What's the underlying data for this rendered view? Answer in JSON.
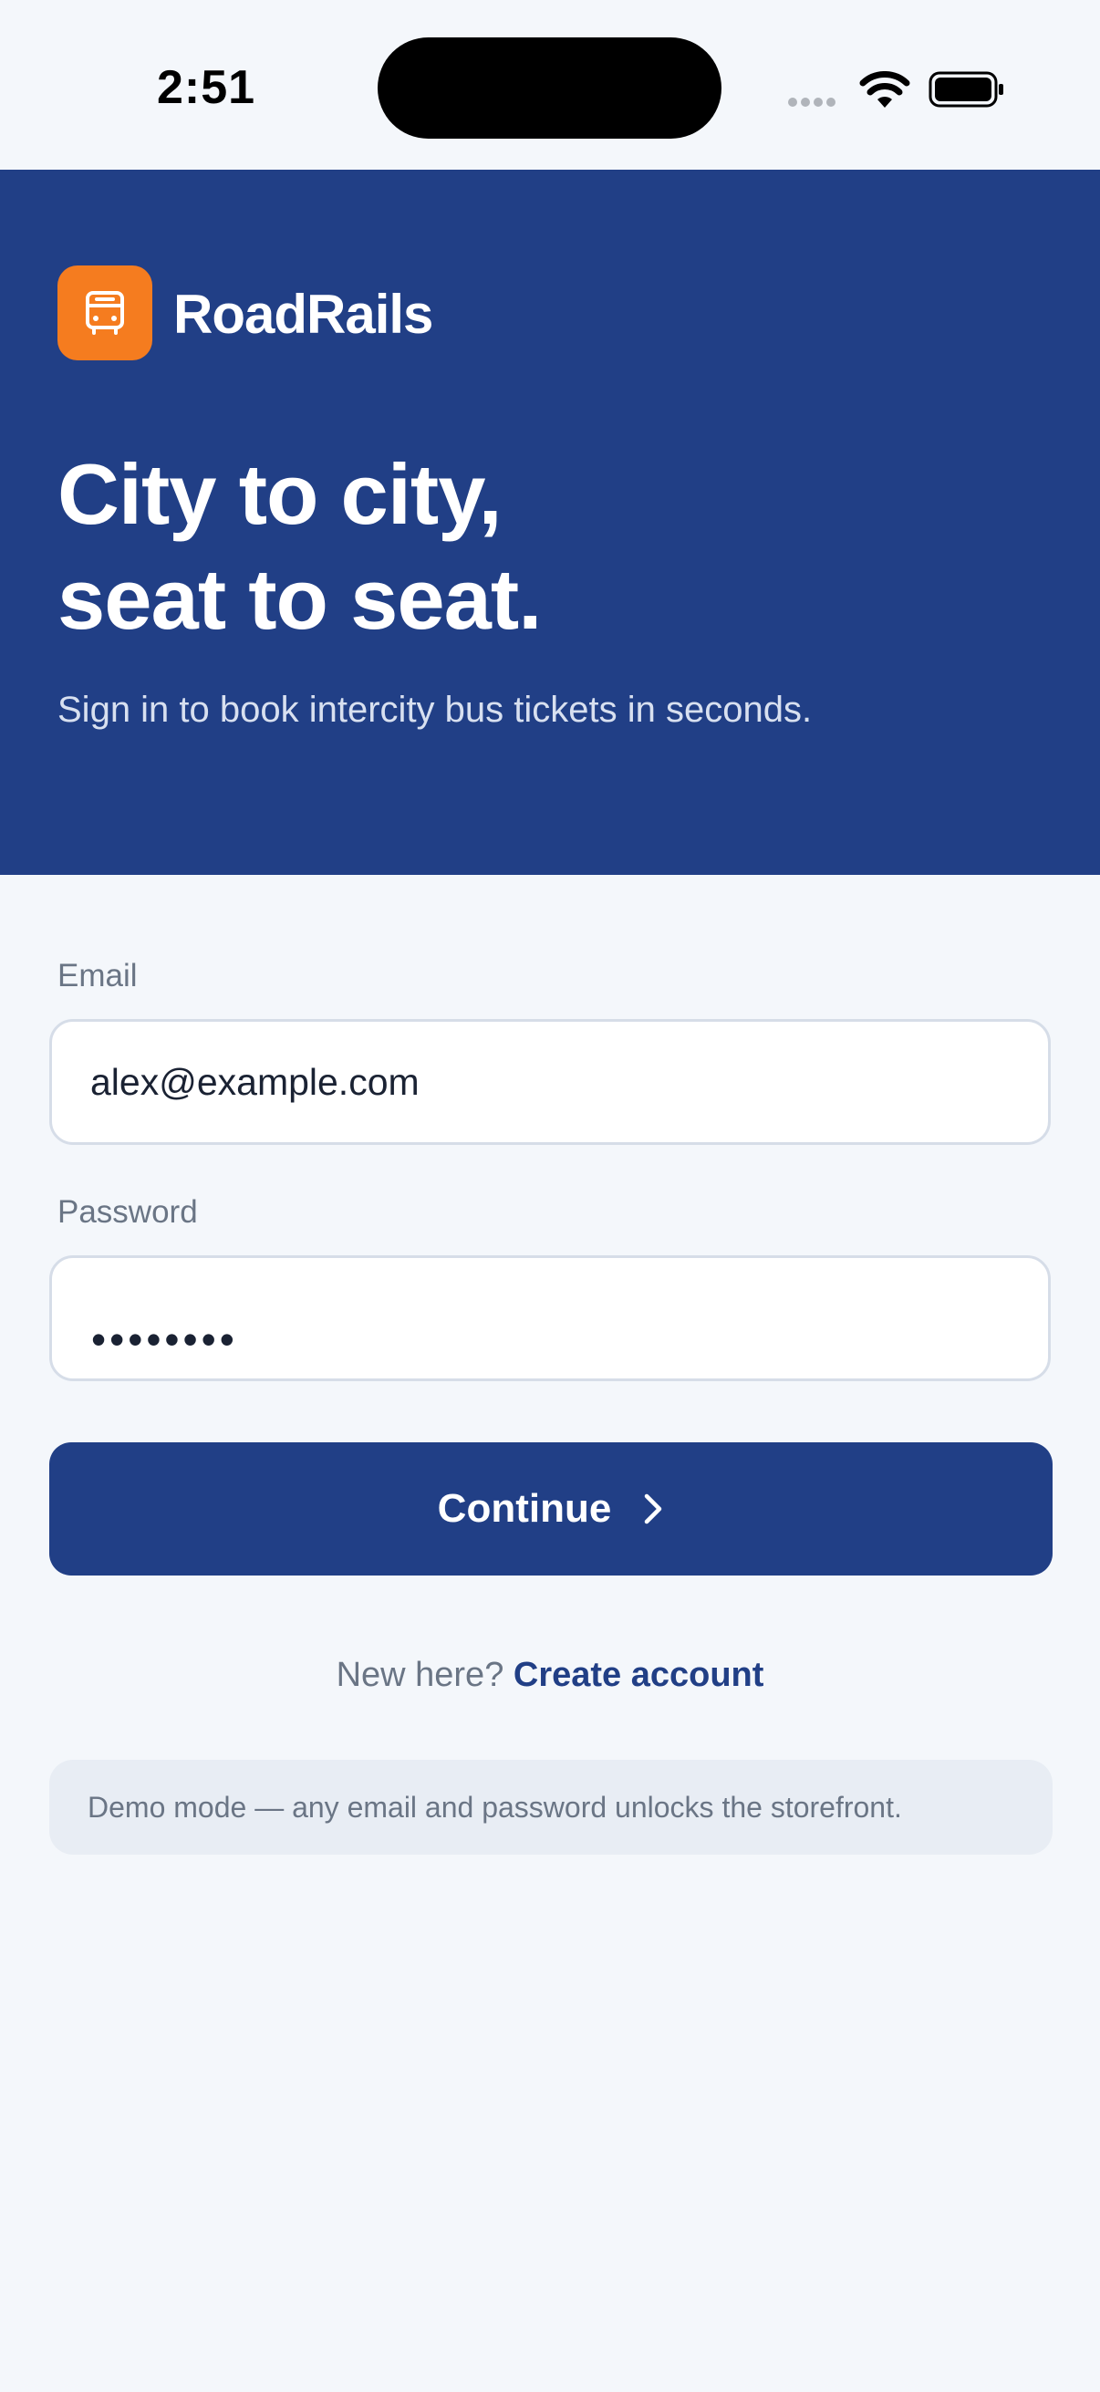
{
  "status_bar": {
    "time": "2:51",
    "icons": [
      "signal-dots-icon",
      "wifi-icon",
      "battery-icon"
    ]
  },
  "brand": {
    "name": "RoadRails",
    "logo_icon": "bus-icon",
    "logo_color": "#f57c1f"
  },
  "hero": {
    "headline_line1": "City to city,",
    "headline_line2": "seat to seat.",
    "subtitle": "Sign in to book intercity bus tickets in seconds.",
    "background_color": "#213f86"
  },
  "form": {
    "email_label": "Email",
    "email_value": "alex@example.com",
    "password_label": "Password",
    "password_mask": "••••••••",
    "continue_label": "Continue",
    "continue_icon": "chevron-right-icon"
  },
  "signup": {
    "prompt": "New here?",
    "link": "Create account"
  },
  "demo_note": "Demo mode — any email and password unlocks the storefront.",
  "colors": {
    "accent": "#213f86",
    "brand_orange": "#f57c1f",
    "page_background": "#f4f7fb"
  }
}
